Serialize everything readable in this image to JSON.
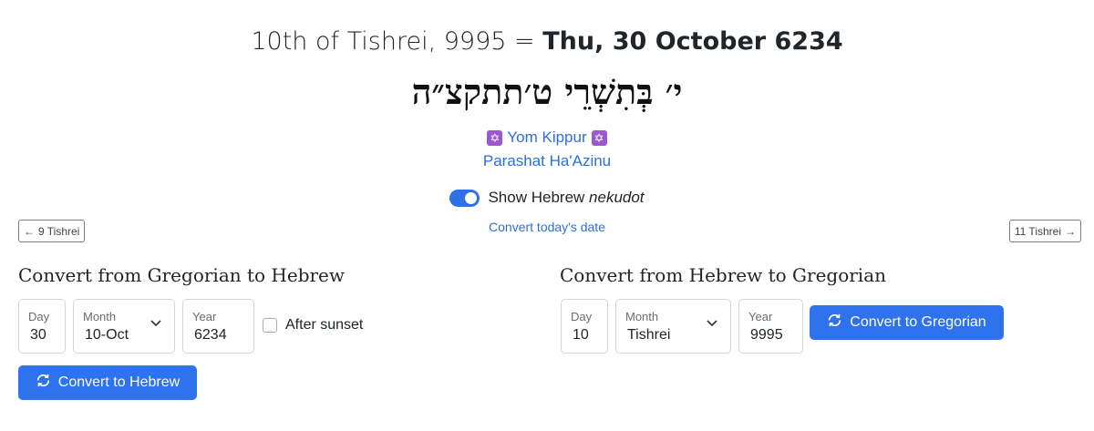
{
  "headline": {
    "hebrew_date_text": "10th of Tishrei, 9995 = ",
    "gregorian_date_text": "Thu, 30 October 6234"
  },
  "hebrew_rendering": "י׳ בְּתִשְׁרֵי ט׳תתקצ״ה",
  "holiday": {
    "name": "Yom Kippur",
    "icon": "star-of-david-icon",
    "icon_color": "#9b59d0"
  },
  "parasha": "Parashat Ha'Azinu",
  "nekudot_toggle": {
    "label_prefix": "Show Hebrew ",
    "label_emphasis": "nekudot",
    "enabled": true
  },
  "convert_today_label": "Convert today's date",
  "nav": {
    "prev_label": "9 Tishrei",
    "next_label": "11 Tishrei"
  },
  "greg_to_heb": {
    "title": "Convert from Gregorian to Hebrew",
    "day_label": "Day",
    "day_value": "30",
    "month_label": "Month",
    "month_value": "10-Oct",
    "year_label": "Year",
    "year_value": "6234",
    "after_sunset_label": "After sunset",
    "after_sunset_checked": false,
    "button_label": "Convert to Hebrew"
  },
  "heb_to_greg": {
    "title": "Convert from Hebrew to Gregorian",
    "day_label": "Day",
    "day_value": "10",
    "month_label": "Month",
    "month_value": "Tishrei",
    "year_label": "Year",
    "year_value": "9995",
    "button_label": "Convert to Gregorian"
  },
  "colors": {
    "accent": "#2f72ee",
    "link": "#2b6fe0"
  }
}
